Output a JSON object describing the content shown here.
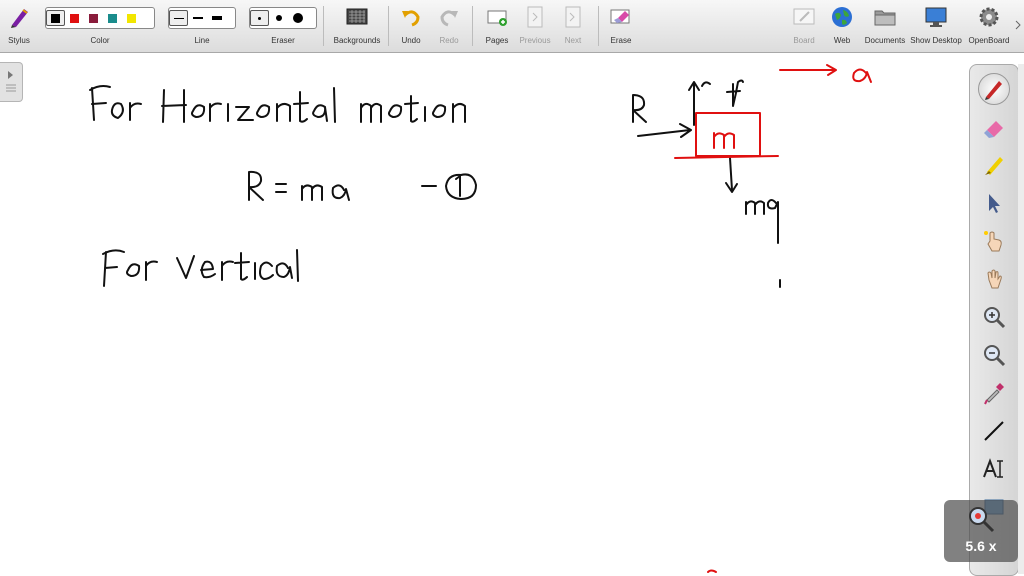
{
  "toolbar": {
    "stylus": "Stylus",
    "color": "Color",
    "line": "Line",
    "eraser": "Eraser",
    "backgrounds": "Backgrounds",
    "undo": "Undo",
    "redo": "Redo",
    "pages": "Pages",
    "previous": "Previous",
    "next": "Next",
    "erase": "Erase",
    "board": "Board",
    "web": "Web",
    "documents": "Documents",
    "show_desktop": "Show Desktop",
    "openboard": "OpenBoard"
  },
  "colors": {
    "swatches": [
      "#000000",
      "#e01010",
      "#8a1c3c",
      "#1a8c8c",
      "#f2e600"
    ],
    "ink_black": "#111111",
    "ink_red": "#e01010"
  },
  "zoom": {
    "label": "5.6 x"
  },
  "right_tools": [
    "pen-icon",
    "eraser-icon",
    "highlighter-icon",
    "pointer-icon",
    "laser-pointer-icon",
    "hand-icon",
    "zoom-in-icon",
    "zoom-out-icon",
    "pipette-icon",
    "line-icon",
    "text-tool-icon",
    "capture-icon"
  ],
  "board": {
    "line1": "For Horizontal motion",
    "eq1": "R = ma",
    "eq1_number": "1",
    "line2": "For vertical",
    "diagram": {
      "block_label": "m",
      "force_left": "R",
      "force_up": "f",
      "force_down": "mg",
      "acceleration": "a"
    }
  }
}
